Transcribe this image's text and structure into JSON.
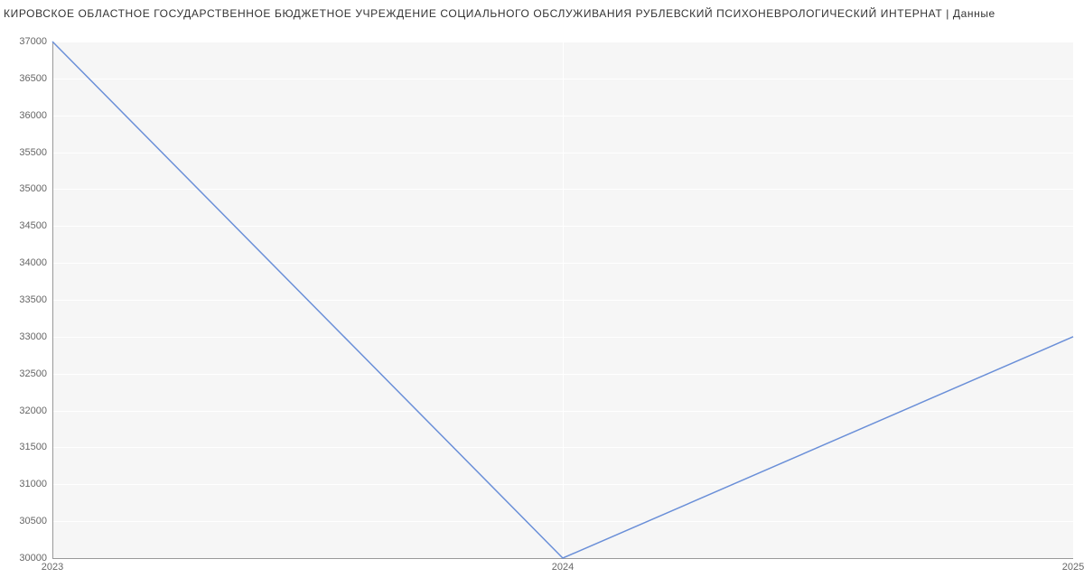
{
  "chart_data": {
    "type": "line",
    "title": "КИРОВСКОЕ ОБЛАСТНОЕ ГОСУДАРСТВЕННОЕ БЮДЖЕТНОЕ УЧРЕЖДЕНИЕ СОЦИАЛЬНОГО ОБСЛУЖИВАНИЯ РУБЛЕВСКИЙ ПСИХОНЕВРОЛОГИЧЕСКИЙ ИНТЕРНАТ | Данные",
    "xlabel": "",
    "ylabel": "",
    "x": [
      2023,
      2024,
      2025
    ],
    "values": [
      37000,
      30000,
      33000
    ],
    "xlim": [
      2023,
      2025
    ],
    "ylim": [
      30000,
      37000
    ],
    "x_ticks": [
      "2023",
      "2024",
      "2025"
    ],
    "y_ticks": [
      "30000",
      "30500",
      "31000",
      "31500",
      "32000",
      "32500",
      "33000",
      "33500",
      "34000",
      "34500",
      "35000",
      "35500",
      "36000",
      "36500",
      "37000"
    ],
    "colors": {
      "line": "#6a8fd8",
      "plot_bg": "#f6f6f6"
    }
  }
}
